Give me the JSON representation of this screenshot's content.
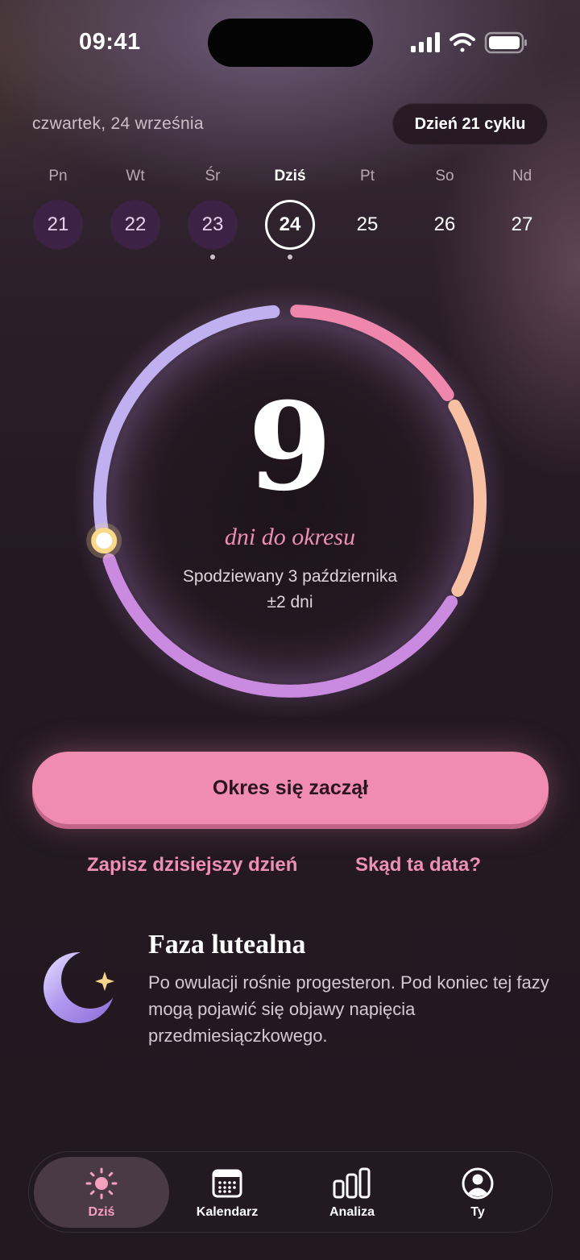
{
  "status": {
    "time": "09:41"
  },
  "header": {
    "date": "czwartek, 24 września",
    "cycle_badge": "Dzień 21 cyklu"
  },
  "week": [
    {
      "name": "Pn",
      "num": "21",
      "state": "logged",
      "dot": false
    },
    {
      "name": "Wt",
      "num": "22",
      "state": "logged",
      "dot": false
    },
    {
      "name": "Śr",
      "num": "23",
      "state": "logged",
      "dot": true
    },
    {
      "name": "Dziś",
      "num": "24",
      "state": "today",
      "dot": true
    },
    {
      "name": "Pt",
      "num": "25",
      "state": "future",
      "dot": false
    },
    {
      "name": "So",
      "num": "26",
      "state": "future",
      "dot": false
    },
    {
      "name": "Nd",
      "num": "27",
      "state": "future",
      "dot": false
    }
  ],
  "countdown": {
    "days": "9",
    "label": "dni do okresu",
    "expected": "Spodziewany 3 października",
    "margin": "±2 dni",
    "cycle_progress": 0.7
  },
  "actions": {
    "main_button": "Okres się zaczął",
    "log_today": "Zapisz dzisiejszy dzień",
    "why_date": "Skąd ta data?"
  },
  "phase": {
    "title": "Faza lutealna",
    "description": "Po owulacji rośnie progesteron. Pod koniec tej fazy mogą pojawić się objawy napięcia przedmiesiączkowego."
  },
  "tabs": [
    {
      "label": "Dziś",
      "icon": "sun-icon",
      "active": true
    },
    {
      "label": "Kalendarz",
      "icon": "calendar-icon",
      "active": false
    },
    {
      "label": "Analiza",
      "icon": "bar-chart-icon",
      "active": false
    },
    {
      "label": "Ty",
      "icon": "profile-icon",
      "active": false
    }
  ],
  "colors": {
    "accent_pink": "#f08cb0",
    "ring_pink": "#ef87ad",
    "ring_peach": "#f8c0a2",
    "ring_purple": "#c98ae0",
    "ring_lavender": "#c0b0f0",
    "marker": "#f8d98a"
  }
}
